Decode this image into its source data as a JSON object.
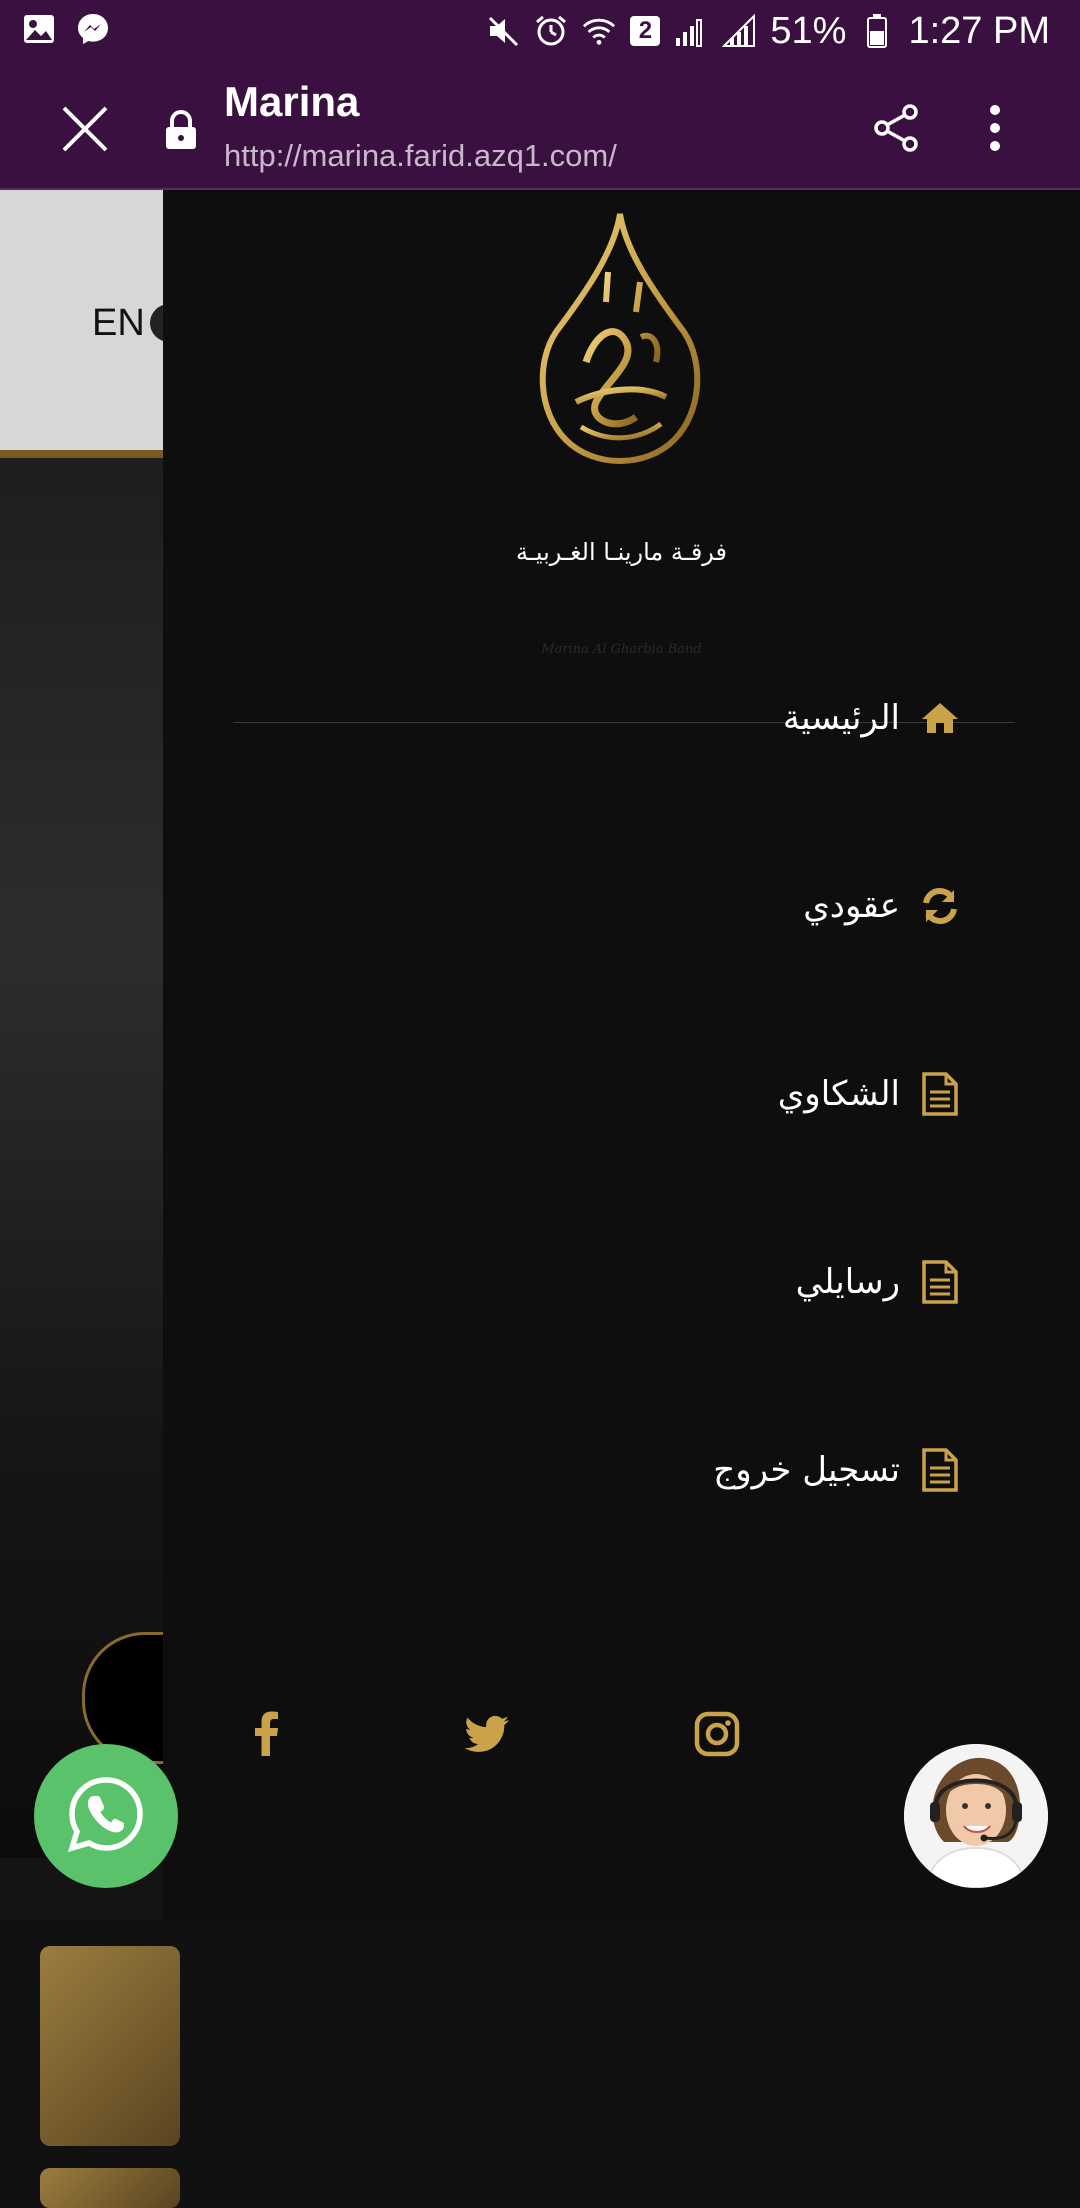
{
  "status_bar": {
    "battery": "51%",
    "time": "1:27 PM",
    "sim_badge": "2",
    "icons": [
      "gallery-icon",
      "messenger-icon",
      "mute-icon",
      "alarm-icon",
      "wifi-icon",
      "signal-icon",
      "battery-icon"
    ]
  },
  "browser": {
    "title": "Marina",
    "url": "http://marina.farid.azq1.com/",
    "icons": [
      "close-icon",
      "lock-icon",
      "share-icon",
      "more-icon"
    ]
  },
  "page": {
    "language_label": "EN"
  },
  "drawer": {
    "brand_name": "فرقـة مارينـا الغـربيـة",
    "tagline": "Marina  Al Gharbia Band",
    "menu": [
      {
        "label": "الرئيسية",
        "icon": "home-icon"
      },
      {
        "label": "عقودي",
        "icon": "refresh-icon"
      },
      {
        "label": "الشكاوي",
        "icon": "document-icon"
      },
      {
        "label": "رسايلي",
        "icon": "document-icon"
      },
      {
        "label": "تسجيل خروج",
        "icon": "document-icon"
      }
    ],
    "social": [
      "facebook-icon",
      "twitter-icon",
      "instagram-icon"
    ]
  },
  "colors": {
    "brand_purple": "#3a1040",
    "gold": "#c9a24a",
    "drawer_bg": "#0e0e0e",
    "whatsapp_green": "#5ac26a"
  },
  "floating": {
    "whatsapp": "whatsapp-icon",
    "support": "support-agent-avatar"
  }
}
